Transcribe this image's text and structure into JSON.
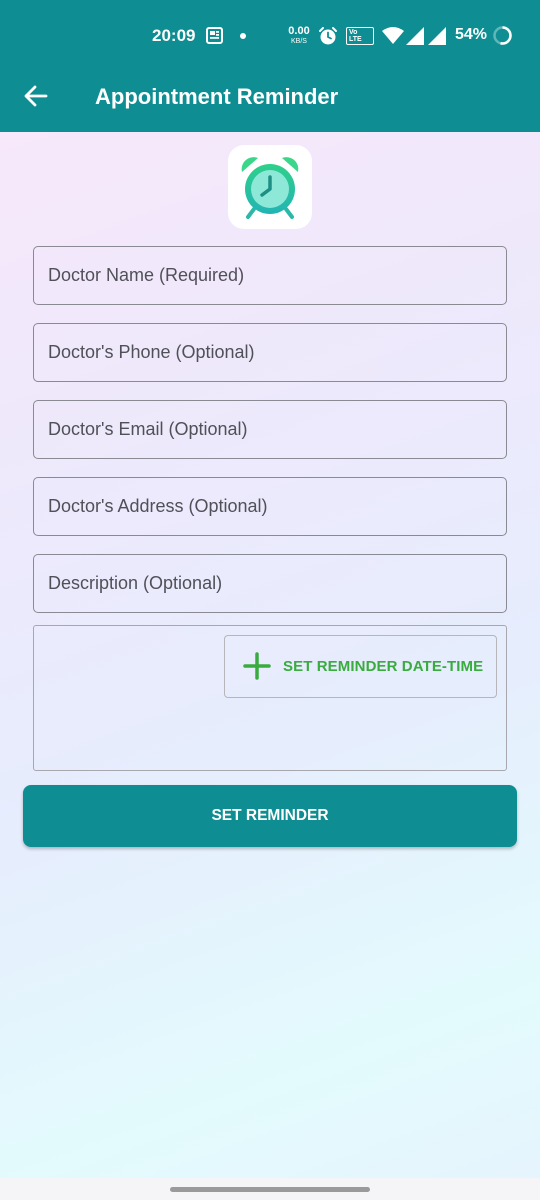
{
  "status_bar": {
    "time": "20:09",
    "net_speed_value": "0.00",
    "net_speed_unit": "KB/S",
    "volte_label": "Vo LTE",
    "battery_percent": "54%"
  },
  "header": {
    "title": "Appointment Reminder",
    "color": "#0e8e92"
  },
  "form": {
    "doctor_name_placeholder": "Doctor Name (Required)",
    "doctor_phone_placeholder": "Doctor's Phone (Optional)",
    "doctor_email_placeholder": "Doctor's Email (Optional)",
    "doctor_address_placeholder": "Doctor's Address (Optional)",
    "description_placeholder": "Description (Optional)",
    "set_datetime_label": "SET REMINDER DATE-TIME",
    "set_datetime_color": "#3aab3f",
    "submit_label": "SET REMINDER"
  },
  "icons": {
    "back": "arrow-left-icon",
    "logo": "alarm-clock-icon",
    "add": "plus-icon"
  }
}
